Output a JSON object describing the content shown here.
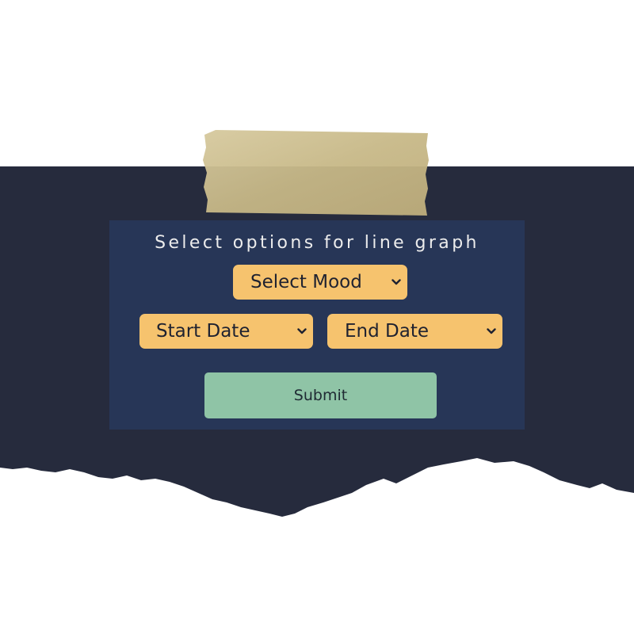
{
  "form": {
    "title": "Select options for line graph",
    "mood_select": {
      "value": "Select Mood",
      "icon": "chevron-down-icon"
    },
    "start_date_select": {
      "value": "Start Date",
      "icon": "chevron-down-icon"
    },
    "end_date_select": {
      "value": "End Date",
      "icon": "chevron-down-icon"
    },
    "submit_label": "Submit"
  },
  "colors": {
    "paper": "#262b3d",
    "card": "#273657",
    "select": "#f6c36e",
    "submit": "#8fc4a6",
    "tape": "#c8b98a",
    "title_text": "#ececec"
  }
}
